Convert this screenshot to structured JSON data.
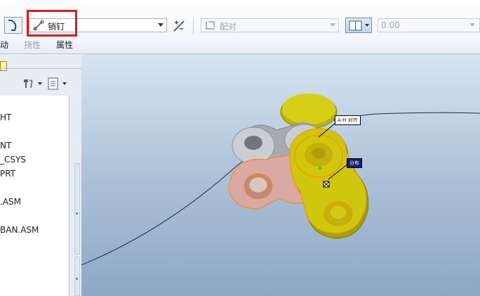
{
  "toolbar": {
    "constraint_type": "销钉",
    "offset_type": "配对",
    "offset_value": "0.00"
  },
  "tabs": {
    "move": "动",
    "flexibility": "挠性",
    "properties": "属性"
  },
  "tree": {
    "items": [
      "HT",
      "NT",
      "_CSYS",
      "PRT",
      ".ASM",
      "BAN.ASM"
    ]
  },
  "viewport": {
    "label_left": "A-H 对齐",
    "label_right": "分布"
  },
  "colors": {
    "highlight": "#e0191f",
    "part_yellow": "#c9c20a",
    "part_gray": "#c3c8cc",
    "part_pink": "#d9a9a4",
    "edge_orange": "#ff8a00"
  }
}
